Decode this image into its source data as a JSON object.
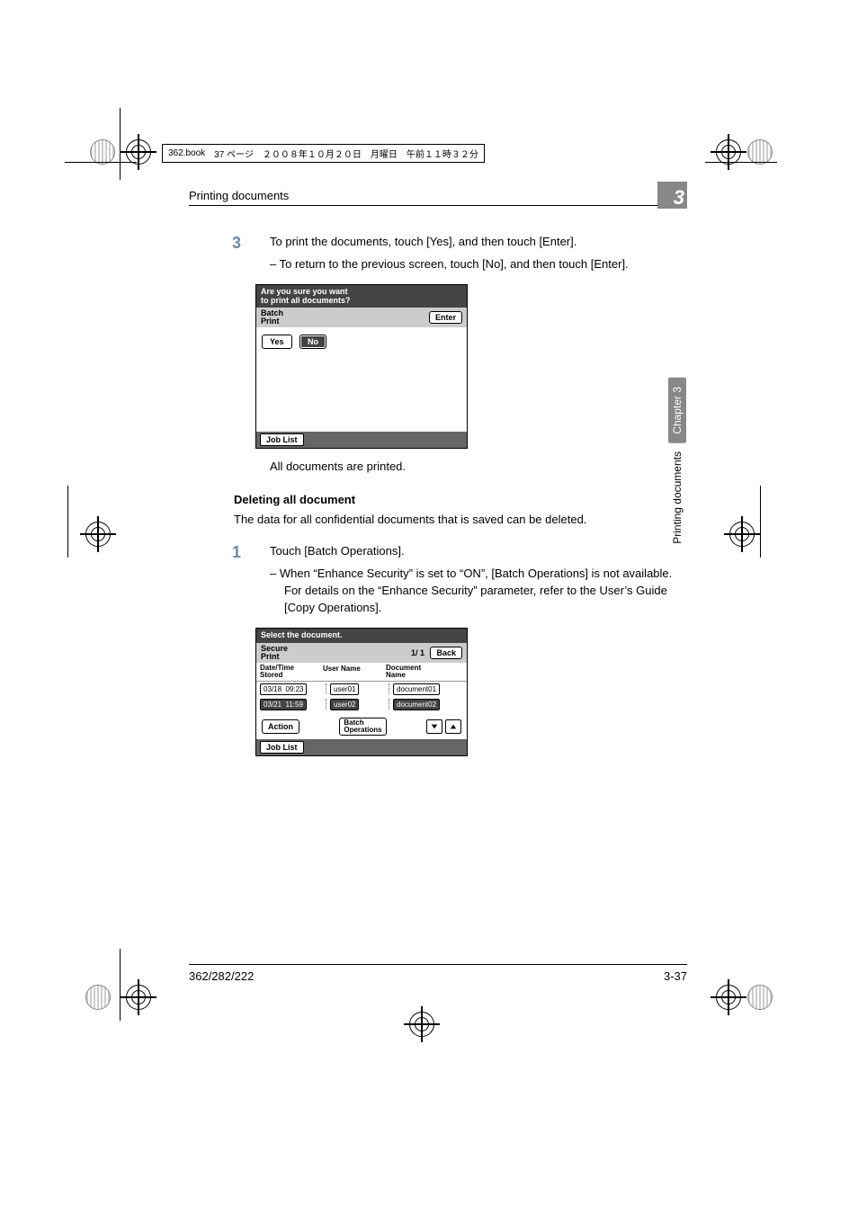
{
  "meta": {
    "file": "362.book",
    "page_jp": "37 ページ",
    "date_jp": "２００８年１０月２０日",
    "weekday_jp": "月曜日",
    "time_jp": "午前１１時３２分"
  },
  "header": {
    "title": "Printing documents",
    "chapter_num": "3"
  },
  "side": {
    "chapter_label": "Chapter 3",
    "running_title": "Printing documents"
  },
  "body": {
    "step3_num": "3",
    "step3_text": "To print the documents, touch [Yes], and then touch [Enter].",
    "step3_bullet": "– To return to the previous screen, touch [No], and then touch [Enter].",
    "result_text": "All documents are printed.",
    "subheading": "Deleting all document",
    "delete_intro": "The data for all confidential documents that is saved can be deleted.",
    "step1_num": "1",
    "step1_text": "Touch [Batch Operations].",
    "step1_bullet": "– When “Enhance Security” is set to “ON”, [Batch Operations] is not available. For details on the “Enhance Security” parameter, refer to the User’s Guide [Copy Operations]."
  },
  "panel1": {
    "title_line1": "Are you sure you want",
    "title_line2": "to print all documents?",
    "mode_label": "Batch\nPrint",
    "enter": "Enter",
    "yes": "Yes",
    "no": "No",
    "job_list": "Job List"
  },
  "panel2": {
    "title": "Select the document.",
    "mode_label": "Secure\nPrint",
    "page_indicator": "1/ 1",
    "back": "Back",
    "col_datetime": "Date/Time\nStored",
    "col_user": "User Name",
    "col_doc": "Document\nName",
    "rows": [
      {
        "date": "03/18",
        "time": "09:23",
        "user": "user01",
        "doc": "document01",
        "selected": false
      },
      {
        "date": "03/21",
        "time": "11:59",
        "user": "user02",
        "doc": "document02",
        "selected": true
      }
    ],
    "action": "Action",
    "batch_ops": "Batch\nOperations",
    "job_list": "Job List"
  },
  "footer": {
    "left": "362/282/222",
    "right": "3-37"
  }
}
